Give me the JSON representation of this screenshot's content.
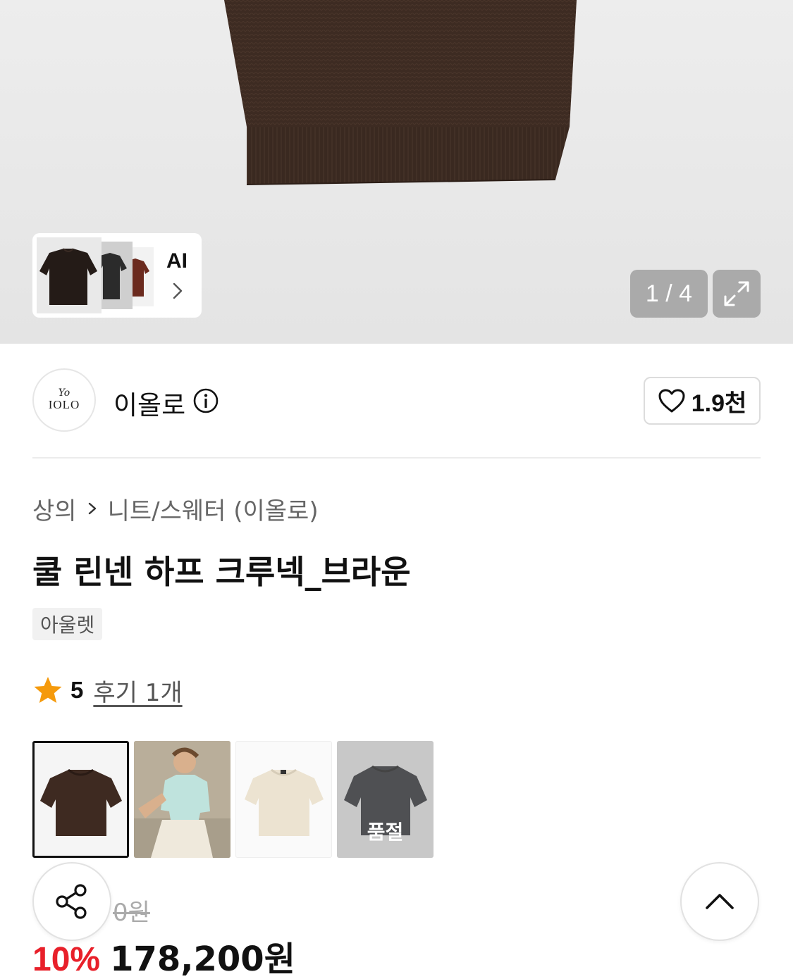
{
  "gallery": {
    "ai_label": "AI",
    "counter": "1 / 4"
  },
  "brand": {
    "name": "이올로",
    "logo_mark": "Yo",
    "logo_text": "IOLO",
    "like_count": "1.9천"
  },
  "breadcrumb": {
    "category": "상의",
    "subcategory": "니트/스웨터 (이올로)"
  },
  "product": {
    "title": "쿨 린넨 하프 크루넥_브라운",
    "badge": "아울렛",
    "rating": "5",
    "review_link": "후기 1개"
  },
  "options": {
    "items": [
      {
        "name": "brown",
        "selected": true,
        "color": "#3e2a21"
      },
      {
        "name": "mint-model",
        "selected": false,
        "color": "#bfe3dd"
      },
      {
        "name": "ivory",
        "selected": false,
        "color": "#ece3d1"
      },
      {
        "name": "black",
        "selected": false,
        "color": "#14161c",
        "soldout": true
      }
    ],
    "soldout_label": "품절"
  },
  "price": {
    "original": "0원",
    "discount": "10%",
    "final": "178,200원"
  },
  "colors": {
    "discount_red": "#e8202a",
    "garment_brown": "#3e2a21"
  },
  "icons": {
    "share": "share-icon",
    "scroll_top": "chevron-up-icon",
    "like": "heart-icon",
    "expand": "expand-icon",
    "info": "info-icon",
    "star": "star-icon"
  }
}
